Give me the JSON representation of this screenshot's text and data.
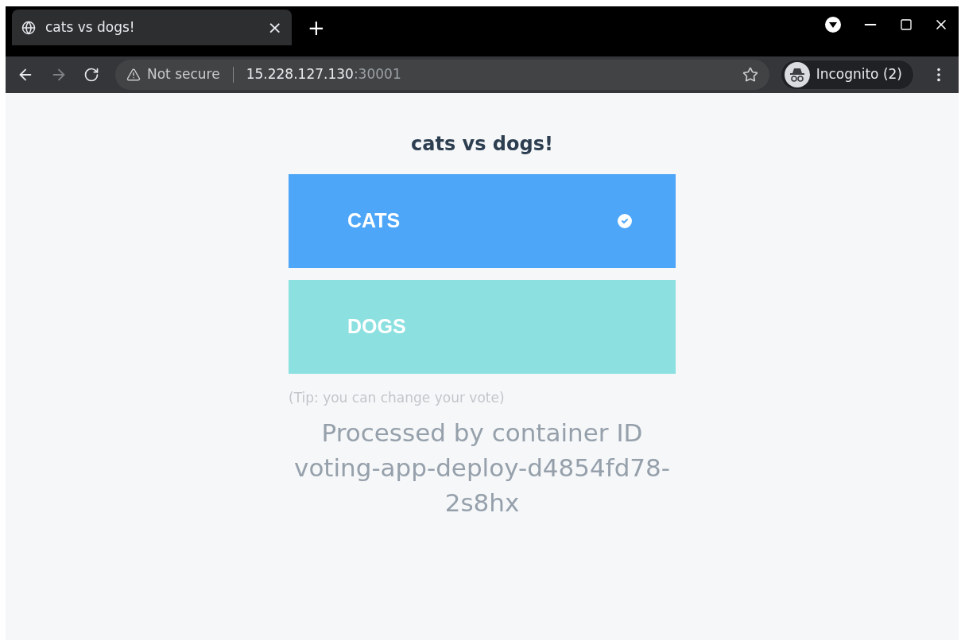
{
  "tab": {
    "title": "cats vs dogs!",
    "close": "×"
  },
  "new_tab": "+",
  "address_bar": {
    "security": "Not secure",
    "host": "15.228.127.130",
    "port": ":30001"
  },
  "profile": {
    "label": "Incognito (2)"
  },
  "page": {
    "heading": "cats vs dogs!",
    "options": [
      {
        "label": "CATS",
        "color": "#4ea6f8",
        "selected": true
      },
      {
        "label": "DOGS",
        "color": "#8ce0e0",
        "selected": false
      }
    ],
    "tip": "(Tip: you can change your vote)",
    "container_info": "Processed by container ID voting-app-deploy-d4854fd78-2s8hx"
  }
}
